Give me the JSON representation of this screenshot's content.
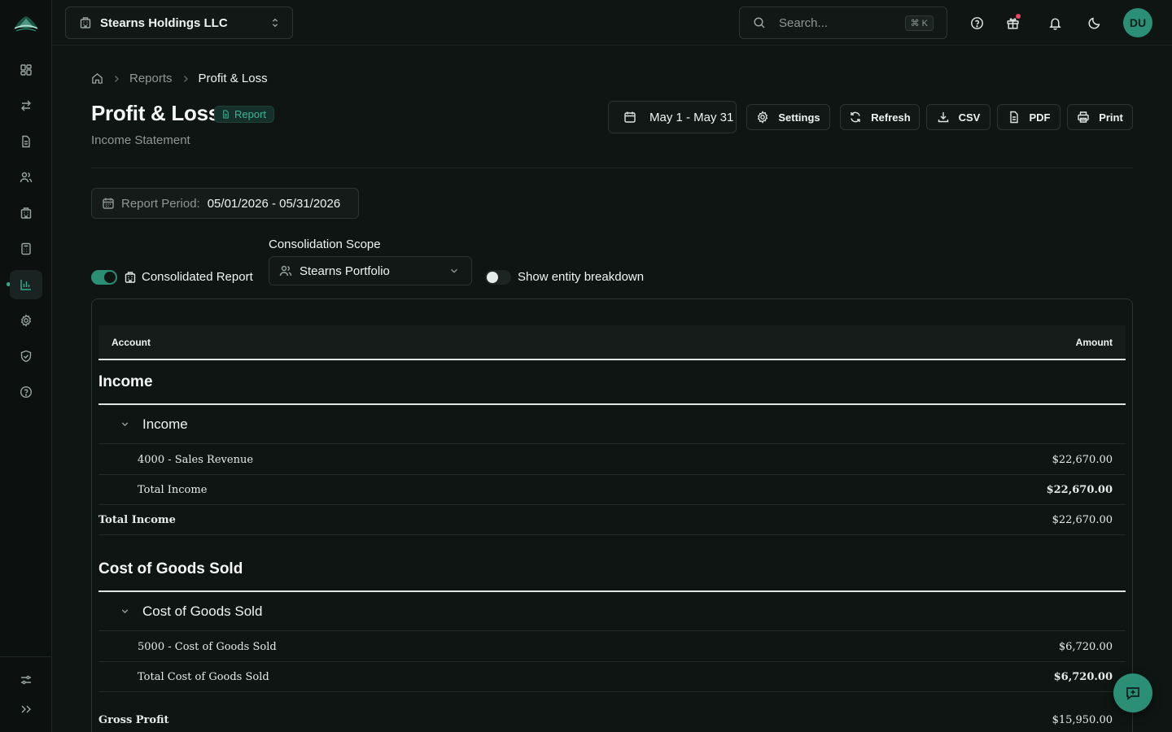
{
  "company": {
    "name": "Stearns Holdings LLC"
  },
  "search": {
    "placeholder": "Search...",
    "shortcut": "⌘ K"
  },
  "user": {
    "initials": "DU"
  },
  "breadcrumb": {
    "items": [
      "Reports",
      "Profit & Loss"
    ]
  },
  "page": {
    "title": "Profit & Loss",
    "badge": "Report",
    "subtitle": "Income Statement"
  },
  "toolbar": {
    "date_range": "May 1 - May 31",
    "settings": "Settings",
    "refresh": "Refresh",
    "csv": "CSV",
    "pdf": "PDF",
    "print": "Print"
  },
  "period": {
    "label": "Report Period:",
    "value": "05/01/2026 - 05/31/2026"
  },
  "controls": {
    "consolidated_label": "Consolidated Report",
    "consolidated_on": true,
    "scope_label": "Consolidation Scope",
    "scope_value": "Stearns Portfolio",
    "breakdown_label": "Show entity breakdown",
    "breakdown_on": false
  },
  "table": {
    "headers": {
      "account": "Account",
      "amount": "Amount"
    },
    "income": {
      "section": "Income",
      "group": "Income",
      "rows": [
        {
          "account": "4000 - Sales Revenue",
          "amount": "$22,670.00"
        },
        {
          "account": "Total Income",
          "amount": "$22,670.00"
        }
      ],
      "total": {
        "account": "Total Income",
        "amount": "$22,670.00"
      }
    },
    "cogs": {
      "section": "Cost of Goods Sold",
      "group": "Cost of Goods Sold",
      "rows": [
        {
          "account": "5000 - Cost of Goods Sold",
          "amount": "$6,720.00"
        },
        {
          "account": "Total Cost of Goods Sold",
          "amount": "$6,720.00"
        }
      ]
    },
    "gross_profit": {
      "account": "Gross Profit",
      "amount": "$15,950.00"
    }
  },
  "colors": {
    "accent": "#2a8f74",
    "background": "#0f1513",
    "notification": "#ef4461"
  },
  "icons": [
    "logo",
    "dashboard-icon",
    "transfer-icon",
    "document-icon",
    "users-icon",
    "building-icon",
    "calculator-icon",
    "chart-icon",
    "gear-icon",
    "shield-icon",
    "help-icon",
    "sliders-icon",
    "expand-icon"
  ]
}
